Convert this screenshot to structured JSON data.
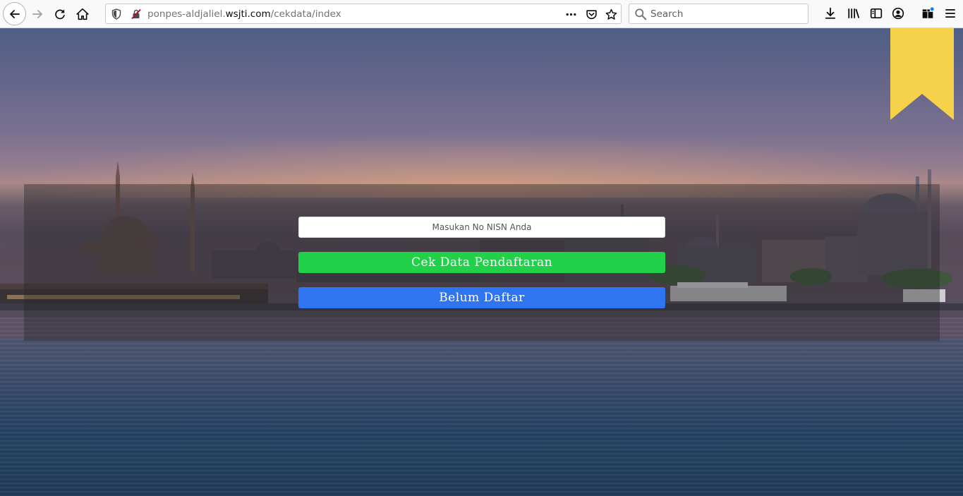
{
  "browser": {
    "url_prefix": "ponpes-aldjaliel.",
    "url_host": "wsjti.com",
    "url_path": "/cekdata/index",
    "search_placeholder": "Search",
    "icons": [
      "back-arrow-icon",
      "forward-arrow-icon",
      "reload-icon",
      "home-icon",
      "shield-icon",
      "insecure-connection-icon",
      "more-dots-icon",
      "pocket-icon",
      "star-icon",
      "search-icon",
      "download-icon",
      "library-icon",
      "sidebar-icon",
      "account-icon",
      "extensions-icon",
      "hamburger-menu-icon"
    ]
  },
  "form": {
    "nisn_placeholder": "Masukan No NISN Anda",
    "nisn_value": "",
    "check_button_label": "Cek Data Pendaftaran",
    "register_button_label": "Belum Daftar"
  },
  "colors": {
    "check_button": "#22d14a",
    "register_button": "#2f74f1",
    "ribbon": "#f5d24a"
  }
}
